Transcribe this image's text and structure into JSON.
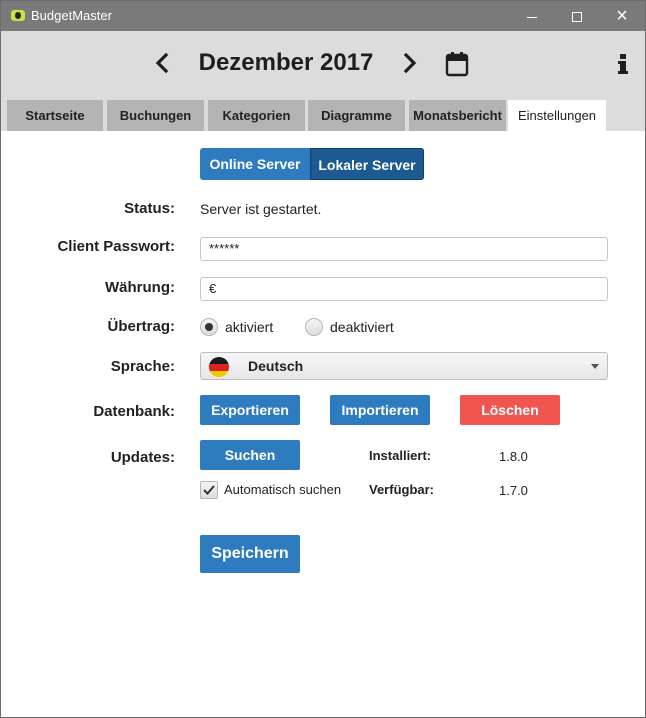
{
  "window": {
    "title": "BudgetMaster",
    "controls": {
      "minimize": "minimize",
      "maximize": "maximize",
      "close": "×"
    }
  },
  "header": {
    "month": "Dezember 2017",
    "prev_icon": "chevron-left-icon",
    "next_icon": "chevron-right-icon",
    "calendar_icon": "calendar-icon",
    "info_icon": "info-icon"
  },
  "tabs": [
    {
      "label": "Startseite",
      "active": false
    },
    {
      "label": "Buchungen",
      "active": false
    },
    {
      "label": "Kategorien",
      "active": false
    },
    {
      "label": "Diagramme",
      "active": false
    },
    {
      "label": "Monatsbericht",
      "active": false
    },
    {
      "label": "Einstellungen",
      "active": true
    }
  ],
  "settings": {
    "server_toggle": {
      "online": "Online Server",
      "local": "Lokaler Server",
      "selected": "Lokaler Server"
    },
    "status": {
      "label": "Status:",
      "value": "Server ist gestartet."
    },
    "password": {
      "label": "Client Passwort:",
      "value": "******"
    },
    "currency": {
      "label": "Währung:",
      "value": "€"
    },
    "carryover": {
      "label": "Übertrag:",
      "option_on": "aktiviert",
      "option_off": "deaktiviert",
      "selected": "aktiviert"
    },
    "language": {
      "label": "Sprache:",
      "value": "Deutsch",
      "flag_icon": "german-flag-icon"
    },
    "database": {
      "label": "Datenbank:",
      "export": "Exportieren",
      "import": "Importieren",
      "delete": "Löschen"
    },
    "updates": {
      "label": "Updates:",
      "search": "Suchen",
      "auto_search": "Automatisch suchen",
      "auto_search_checked": true,
      "installed_label": "Installiert:",
      "installed_value": "1.8.0",
      "available_label": "Verfügbar:",
      "available_value": "1.7.0"
    },
    "save": "Speichern"
  },
  "colors": {
    "titlebar": "#7a7a7a",
    "header_bg": "#dcdcdc",
    "tab_inactive": "#b4b4b4",
    "primary": "#2f7bc0",
    "primary_dark": "#1d5a92",
    "danger": "#f0554f"
  }
}
